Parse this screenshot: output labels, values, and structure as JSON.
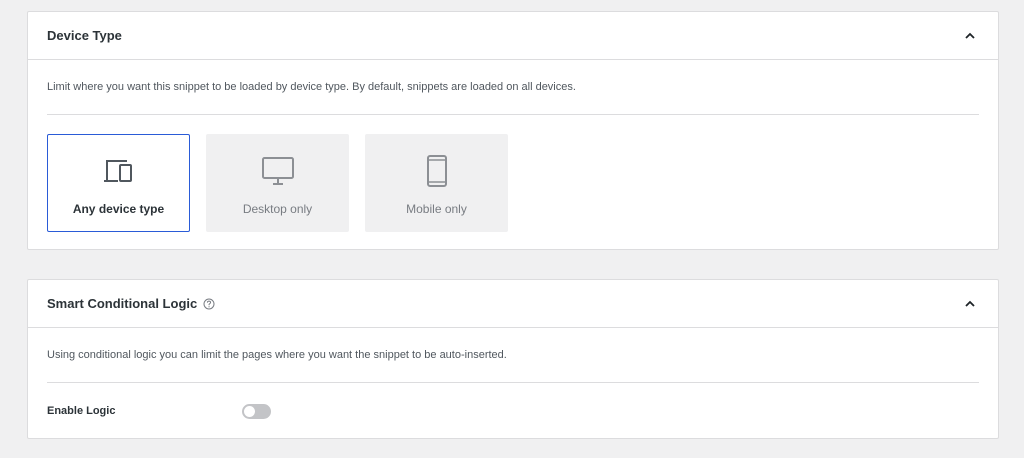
{
  "device_panel": {
    "title": "Device Type",
    "description": "Limit where you want this snippet to be loaded by device type. By default, snippets are loaded on all devices.",
    "options": [
      {
        "label": "Any device type",
        "icon": "devices-icon",
        "selected": true
      },
      {
        "label": "Desktop only",
        "icon": "desktop-icon",
        "selected": false
      },
      {
        "label": "Mobile only",
        "icon": "mobile-icon",
        "selected": false
      }
    ]
  },
  "logic_panel": {
    "title": "Smart Conditional Logic",
    "description": "Using conditional logic you can limit the pages where you want the snippet to be auto-inserted.",
    "enable_label": "Enable Logic",
    "enabled": false
  },
  "colors": {
    "selected_border": "#2a5bd7",
    "toggle_off": "#c3c4c7"
  }
}
